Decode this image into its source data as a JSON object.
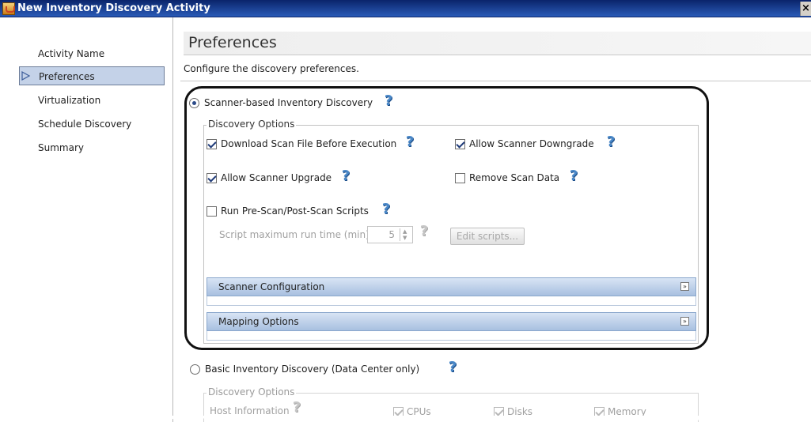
{
  "window": {
    "title": "New Inventory Discovery Activity",
    "close_glyph": "×"
  },
  "nav": {
    "items": [
      {
        "label": "Activity Name",
        "selected": false
      },
      {
        "label": "Preferences",
        "selected": true
      },
      {
        "label": "Virtualization",
        "selected": false
      },
      {
        "label": "Schedule Discovery",
        "selected": false
      },
      {
        "label": "Summary",
        "selected": false
      }
    ]
  },
  "page": {
    "title": "Preferences",
    "description": "Configure the discovery preferences."
  },
  "scanner": {
    "radio_label": "Scanner-based Inventory Discovery",
    "selected": true,
    "options_legend": "Discovery Options",
    "options": {
      "download_scan": {
        "label": "Download Scan File Before Execution",
        "checked": true
      },
      "allow_downgrade": {
        "label": "Allow Scanner Downgrade",
        "checked": true
      },
      "allow_upgrade": {
        "label": "Allow Scanner Upgrade",
        "checked": true
      },
      "remove_scan_data": {
        "label": "Remove Scan Data",
        "checked": false
      },
      "run_scripts": {
        "label": "Run Pre-Scan/Post-Scan Scripts",
        "checked": false
      }
    },
    "script_runtime": {
      "label": "Script maximum run time (min)",
      "value": "5"
    },
    "edit_scripts_label": "Edit scripts...",
    "sections": {
      "scanner_config": "Scanner Configuration",
      "mapping_options": "Mapping Options"
    }
  },
  "basic": {
    "radio_label": "Basic Inventory Discovery (Data Center only)",
    "selected": false,
    "options_legend": "Discovery Options",
    "host_info_label": "Host Information",
    "items": {
      "cpus": {
        "label": "CPUs",
        "checked": true
      },
      "disks": {
        "label": "Disks",
        "checked": true
      },
      "memory": {
        "label": "Memory",
        "checked": true
      }
    }
  },
  "icons": {
    "help": "?",
    "expand": "»"
  },
  "colors": {
    "title_bar": "#0a246a",
    "selected_nav": "#c4d2e8",
    "section_bar": "#a8c0e0",
    "help_icon": "#4a88c8"
  }
}
